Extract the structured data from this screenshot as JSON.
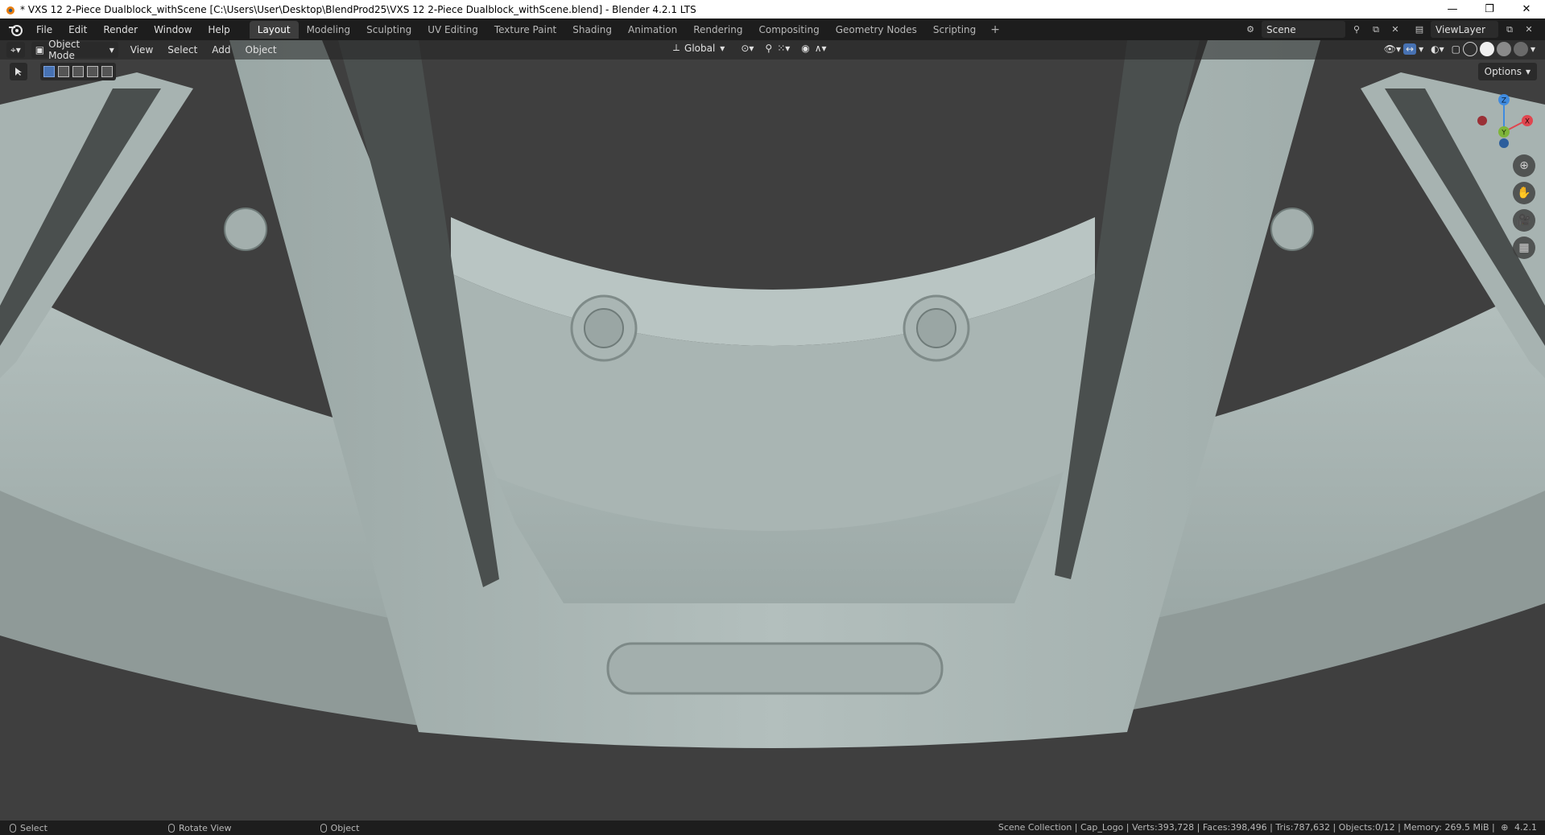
{
  "window": {
    "title": "* VXS 12 2-Piece Dualblock_withScene [C:\\Users\\User\\Desktop\\BlendProd25\\VXS 12 2-Piece Dualblock_withScene.blend] - Blender 4.2.1 LTS",
    "minimize": "—",
    "restore": "❐",
    "close": "✕"
  },
  "menus": [
    "File",
    "Edit",
    "Render",
    "Window",
    "Help"
  ],
  "workspaces": [
    "Layout",
    "Modeling",
    "Sculpting",
    "UV Editing",
    "Texture Paint",
    "Shading",
    "Animation",
    "Rendering",
    "Compositing",
    "Geometry Nodes",
    "Scripting"
  ],
  "active_workspace": "Layout",
  "add_workspace": "+",
  "scene_name": "Scene",
  "view_layer": "ViewLayer",
  "viewport_header": {
    "mode": "Object Mode",
    "menus": [
      "View",
      "Select",
      "Add",
      "Object"
    ],
    "orientation": "Global"
  },
  "options_label": "Options",
  "gizmo": {
    "z": "Z",
    "x": "X",
    "y": "Y"
  },
  "status": {
    "select": "Select",
    "rotate": "Rotate View",
    "object": "Object",
    "stats": "Scene Collection | Cap_Logo | Verts:393,728 | Faces:398,496 | Tris:787,632 | Objects:0/12 | Memory: 269.5 MiB |",
    "version": "4.2.1"
  },
  "colors": {
    "axis_x": "#e0464f",
    "axis_y": "#7fb53a",
    "axis_z": "#3f8be0",
    "model": "#a9b6b4"
  }
}
